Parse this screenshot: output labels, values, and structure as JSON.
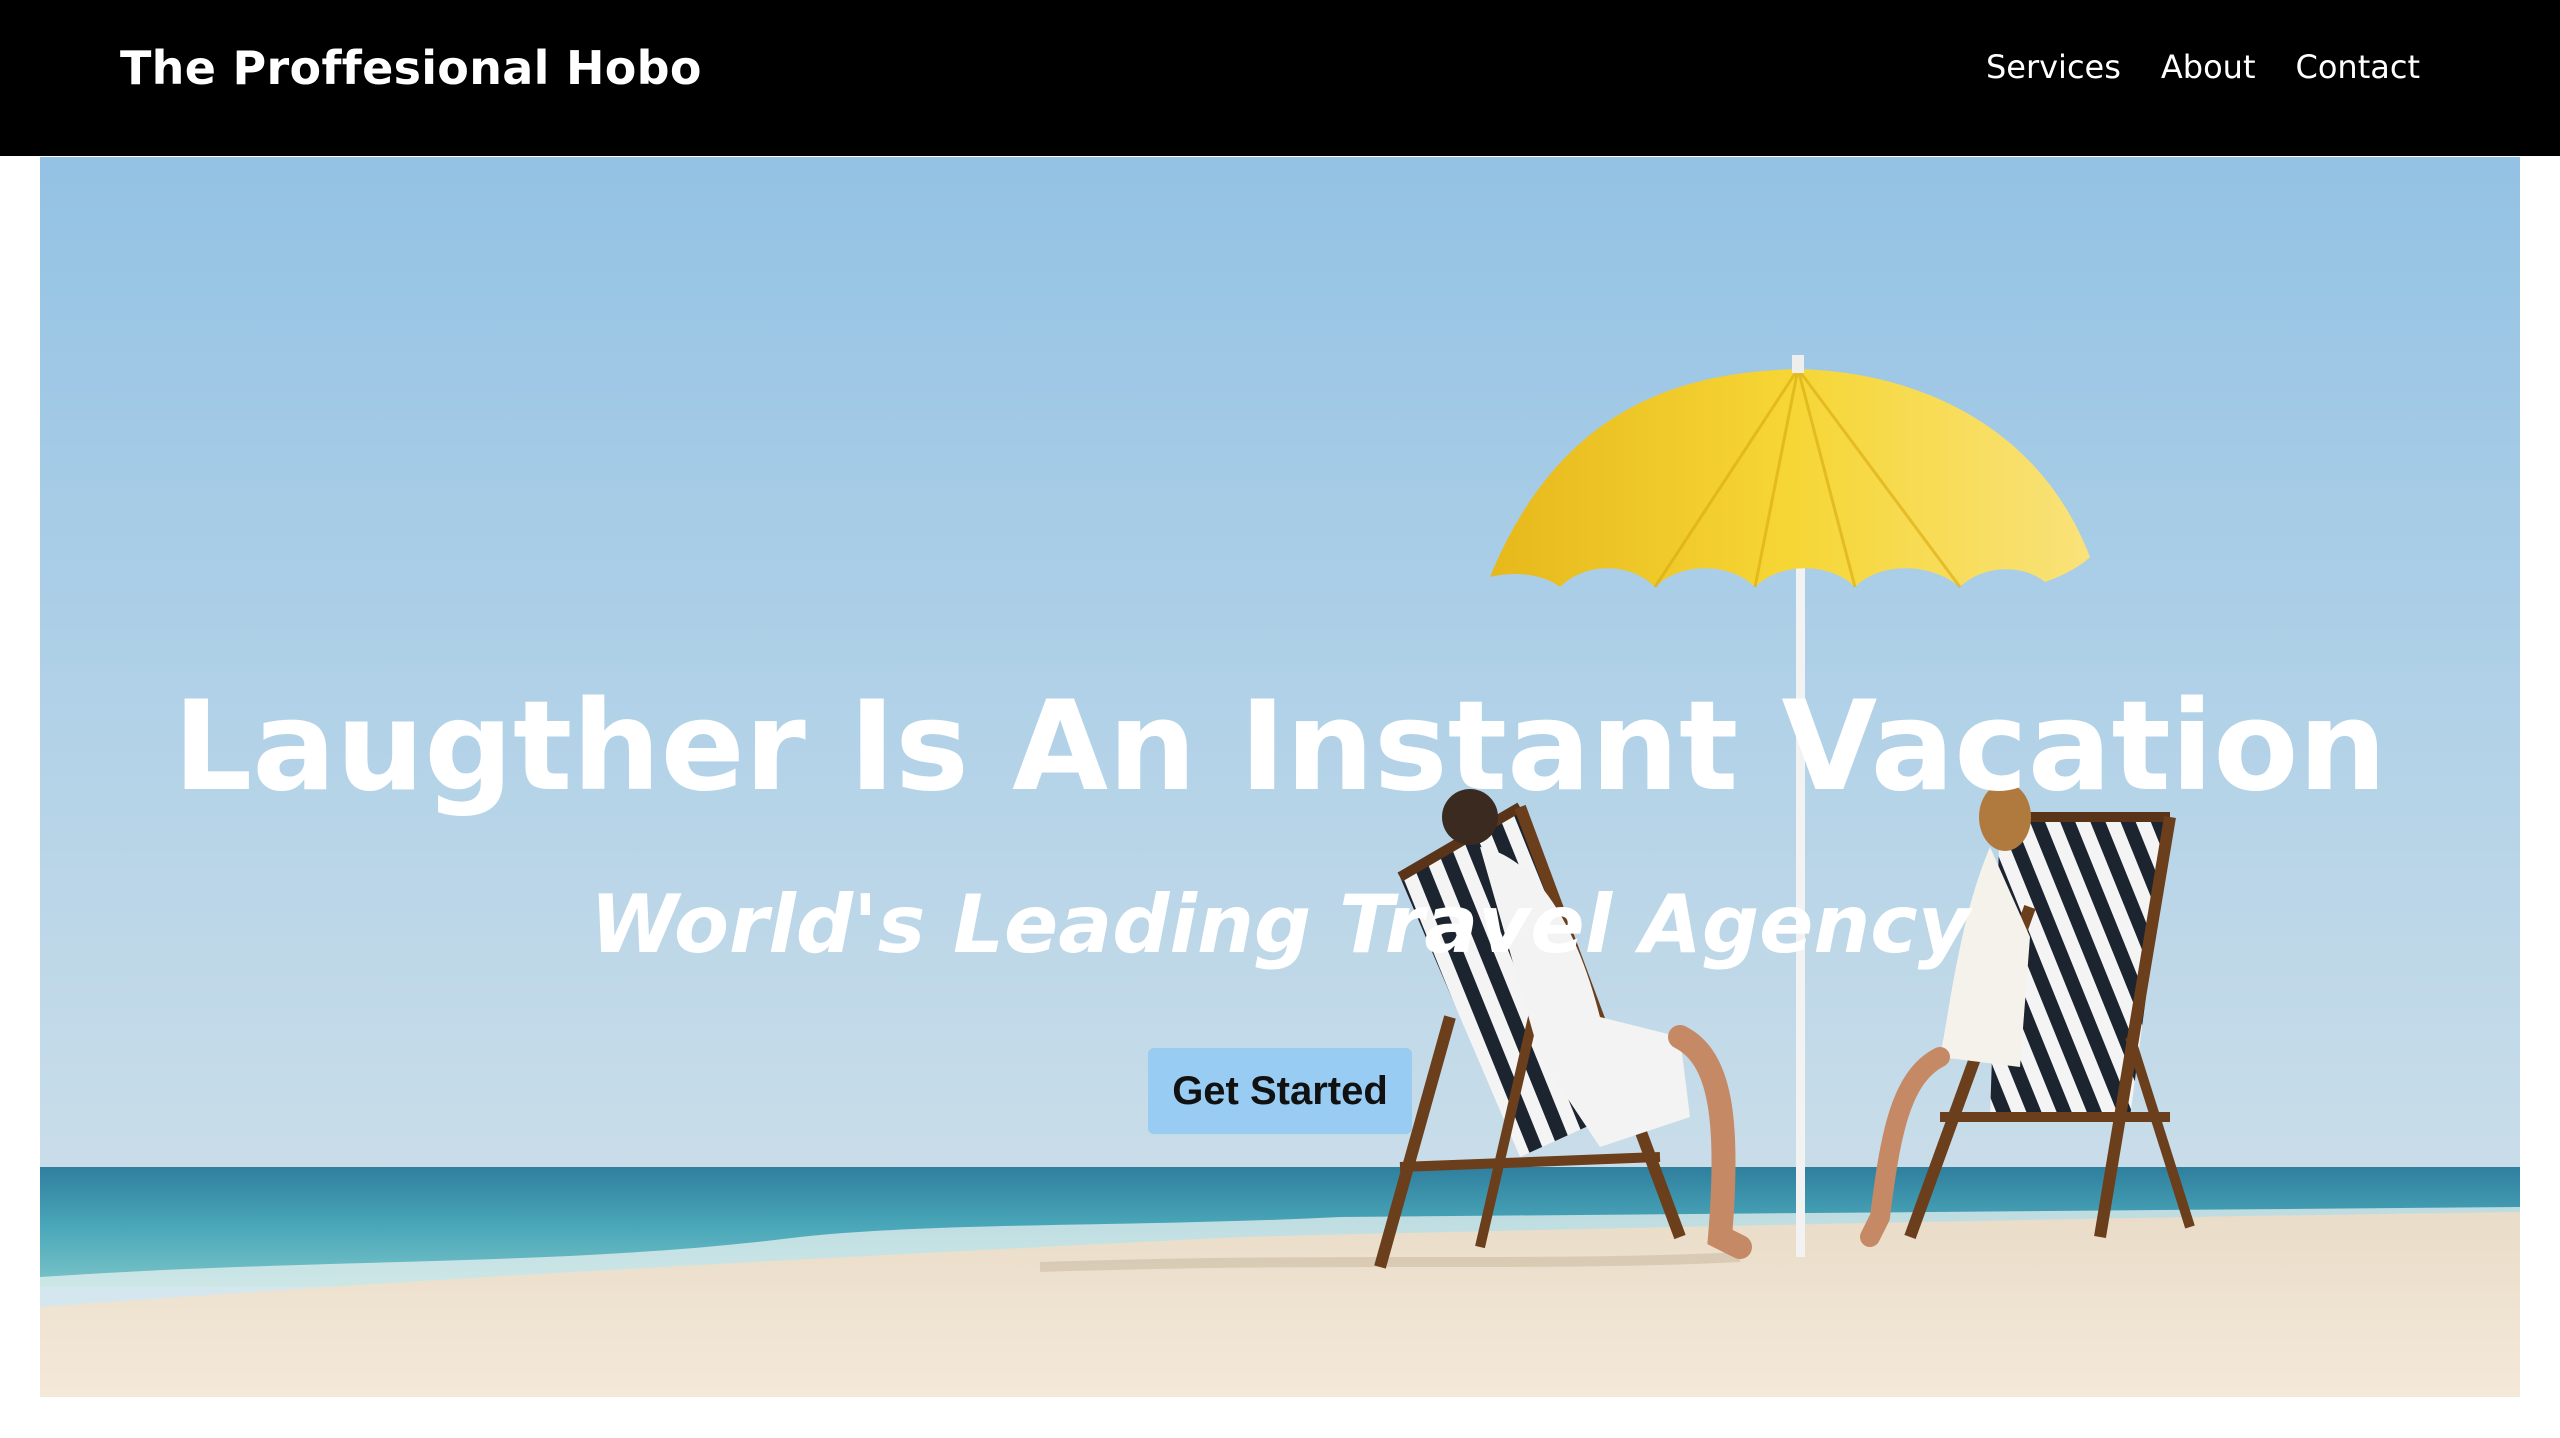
{
  "nav": {
    "brand": "The Proffesional Hobo",
    "links": [
      "Services",
      "About",
      "Contact"
    ]
  },
  "hero": {
    "title": "Laugther Is An Instant Vacation",
    "subtitle": "World's Leading Travel Agency",
    "cta_label": "Get Started",
    "image": "beach-umbrella-lounge-chairs"
  },
  "colors": {
    "navbar_bg": "#000000",
    "nav_text": "#ffffff",
    "cta_bg": "#99ccf3",
    "umbrella": "#f3d12b",
    "sky": "#9dc6e6",
    "sea": "#3a9fb5",
    "sand": "#efe2cf"
  }
}
